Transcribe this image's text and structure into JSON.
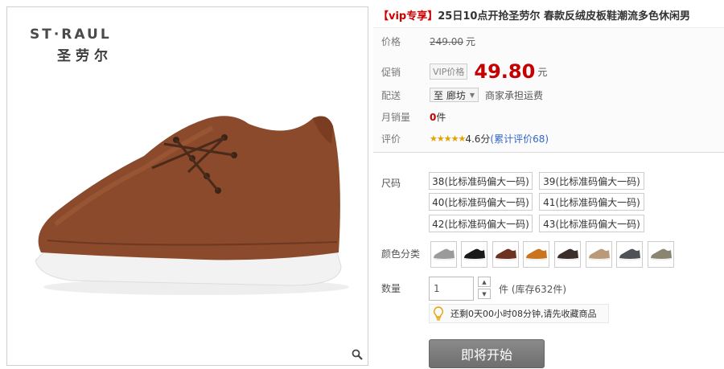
{
  "brand": {
    "name_en": "ST·RAUL",
    "name_cn": "圣劳尔"
  },
  "title": {
    "prefix": "【vip专享】",
    "text": "25日10点开抢圣劳尔 春款反绒皮板鞋潮流多色休闲男"
  },
  "price": {
    "label": "价格",
    "value": "249.00",
    "unit": "元"
  },
  "promo": {
    "label": "促销",
    "tag": "VIP价格",
    "value": "49.80",
    "unit": "元"
  },
  "shipping": {
    "label": "配送",
    "location": "至 廊坊",
    "note": "商家承担运费"
  },
  "sales": {
    "label": "月销量",
    "count": "0",
    "unit": "件"
  },
  "rating": {
    "label": "评价",
    "stars": "★★★★★",
    "score": "4.6分",
    "link": "(累计评价68)"
  },
  "size": {
    "label": "尺码",
    "options": [
      "38(比标准码偏大一码)",
      "39(比标准码偏大一码)",
      "40(比标准码偏大一码)",
      "41(比标准码偏大一码)",
      "42(比标准码偏大一码)",
      "43(比标准码偏大一码)"
    ]
  },
  "color": {
    "label": "颜色分类",
    "swatches": [
      "#9a9a9a",
      "#1a1a1a",
      "#6b3320",
      "#c8751e",
      "#3b2e2a",
      "#b89a78",
      "#4e5155",
      "#8a8570"
    ]
  },
  "quantity": {
    "label": "数量",
    "value": "1",
    "stock_note": "件 (库存632件)"
  },
  "reminder": {
    "icon": "lightbulb-icon",
    "text": "还剩0天00小时08分钟,请先收藏商品"
  },
  "action": {
    "label": "即将开始"
  },
  "colors": {
    "accent": "#c40000",
    "link": "#3366cc",
    "star": "#e5a100"
  }
}
